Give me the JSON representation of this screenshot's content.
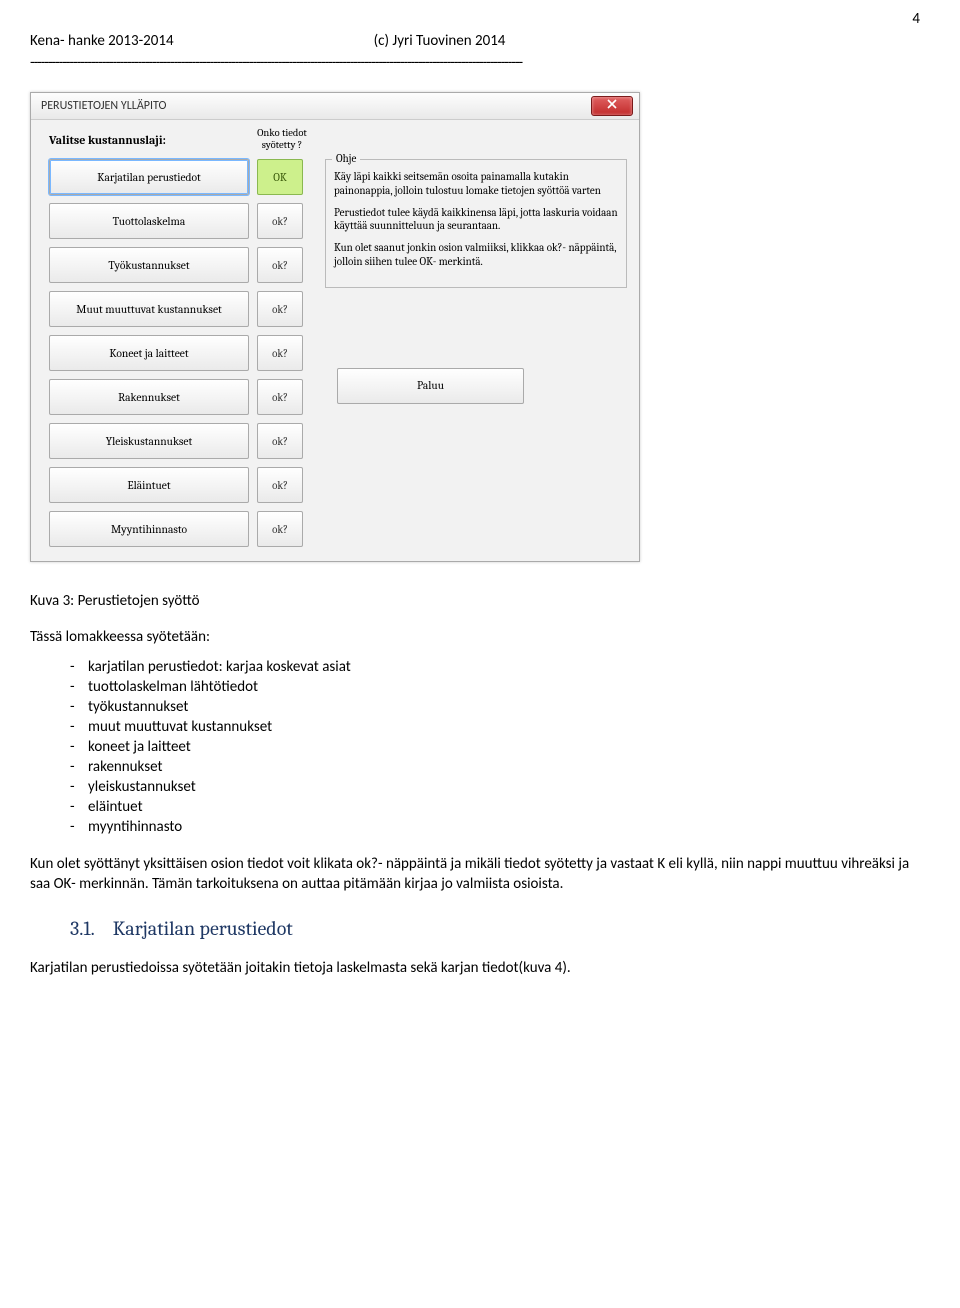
{
  "page": {
    "number": "4",
    "header_left": "Kena- hanke 2013-2014",
    "header_right": "(c) Jyri Tuovinen 2014",
    "separator": "-----------------------------------------------------------------------------------------------------------------------------------------"
  },
  "window": {
    "title": "PERUSTIETOJEN YLLÄPITO",
    "section_label": "Valitse kustannuslaji:",
    "col2_header": "Onko tiedot syötetty ?",
    "categories": [
      {
        "label": "Karjatilan perustiedot",
        "status": "OK",
        "ok": true,
        "selected": true
      },
      {
        "label": "Tuottolaskelma",
        "status": "ok?",
        "ok": false
      },
      {
        "label": "Työkustannukset",
        "status": "ok?",
        "ok": false
      },
      {
        "label": "Muut muuttuvat kustannukset",
        "status": "ok?",
        "ok": false
      },
      {
        "label": "Koneet ja laitteet",
        "status": "ok?",
        "ok": false
      },
      {
        "label": "Rakennukset",
        "status": "ok?",
        "ok": false
      },
      {
        "label": "Yleiskustannukset",
        "status": "ok?",
        "ok": false
      },
      {
        "label": "Eläintuet",
        "status": "ok?",
        "ok": false
      },
      {
        "label": "Myyntihinnasto",
        "status": "ok?",
        "ok": false
      }
    ],
    "ohje": {
      "legend": "Ohje",
      "p1": "Käy läpi kaikki seitsemän osoita painamalla kutakin painonappia, jolloin tulostuu lomake tietojen syöttöä varten",
      "p2": "Perustiedot tulee käydä kaikkinensa läpi, jotta laskuria voidaan käyttää suunnitteluun ja seurantaan.",
      "p3": "Kun olet saanut jonkin osion valmiiksi, klikkaa ok?- näppäintä, jolloin siihen tulee OK- merkintä."
    },
    "paluu_label": "Paluu"
  },
  "body": {
    "caption": "Kuva 3: Perustietojen syöttö",
    "subhead": "Tässä lomakkeessa syötetään:",
    "list": [
      "karjatilan perustiedot: karjaa koskevat asiat",
      "tuottolaskelman lähtötiedot",
      "työkustannukset",
      "muut muuttuvat kustannukset",
      "koneet ja laitteet",
      "rakennukset",
      "yleiskustannukset",
      "eläintuet",
      "myyntihinnasto"
    ],
    "para": "Kun olet syöttänyt yksittäisen osion tiedot voit klikata ok?- näppäintä ja mikäli tiedot syötetty ja vastaat K eli kyllä, niin nappi muuttuu vihreäksi ja saa OK- merkinnän. Tämän tarkoituksena on auttaa pitämään kirjaa jo valmiista osioista.",
    "heading_num": "3.1.",
    "heading_text": "Karjatilan perustiedot",
    "para2": "Karjatilan perustiedoissa syötetään joitakin tietoja laskelmasta sekä karjan tiedot(kuva 4)."
  }
}
